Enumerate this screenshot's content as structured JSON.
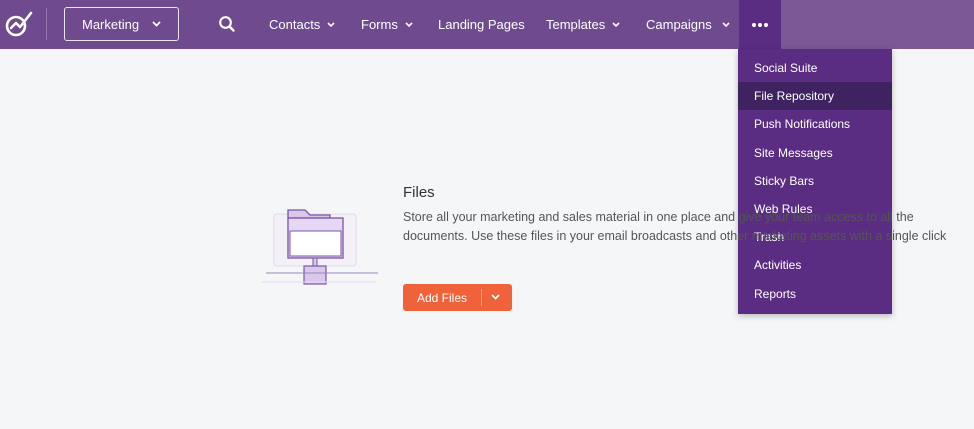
{
  "topbar": {
    "app_switcher": {
      "value": "Marketing"
    },
    "nav": [
      {
        "label": "Contacts",
        "has_dropdown": true
      },
      {
        "label": "Forms",
        "has_dropdown": true
      },
      {
        "label": "Landing Pages",
        "has_dropdown": false
      },
      {
        "label": "Templates",
        "has_dropdown": true
      },
      {
        "label": "Campaigns",
        "has_dropdown": true
      }
    ],
    "more_icon": "ellipsis-icon",
    "colors": {
      "bar": "#6f4a8e",
      "active": "#5a2d82"
    }
  },
  "more_menu": {
    "items": [
      {
        "label": "Social Suite"
      },
      {
        "label": "File Repository",
        "active": true
      },
      {
        "label": "Push Notifications"
      },
      {
        "label": "Site Messages"
      },
      {
        "label": "Sticky Bars"
      },
      {
        "label": "Web Rules"
      },
      {
        "label": "Trash"
      },
      {
        "label": "Activities"
      },
      {
        "label": "Reports"
      }
    ]
  },
  "main": {
    "title": "Files",
    "description": "Store all your marketing and sales material in one place and give your team access to all the documents. Use these files in your email broadcasts and other marketing assets with a single click",
    "add_files_label": "Add Files",
    "accent": "#f0623a"
  }
}
